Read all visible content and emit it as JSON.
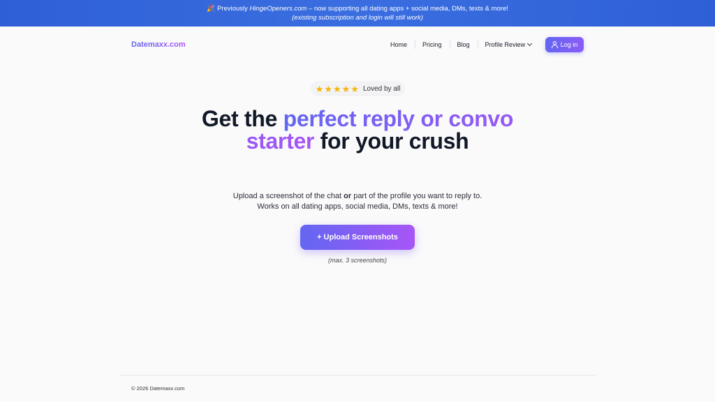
{
  "banner": {
    "emoji": "🎉",
    "prefix": "Previously ",
    "old_domain": "HingeOpeners.com",
    "suffix": " – now supporting all dating apps + social media, DMs, texts & more!",
    "line2": "(existing subscription and login will still work)"
  },
  "nav": {
    "logo": "Datemaxx.com",
    "links": [
      "Home",
      "Pricing",
      "Blog",
      "Profile Review"
    ],
    "login_label": "Log in"
  },
  "rating": {
    "stars": 5,
    "text": "Loved by all"
  },
  "hero": {
    "title_part1": "Get the ",
    "title_highlight": "perfect reply or convo starter",
    "title_part2": " for your crush",
    "sub_part1": "Upload a screenshot of the chat ",
    "sub_bold": "or",
    "sub_part2": " part of the profile you want to reply to.",
    "sub_line2": "Works on all dating apps, social media, DMs, texts & more!",
    "upload_label": "+ Upload Screenshots",
    "max_note": "(max. 3 screenshots)"
  },
  "footer": {
    "copyright": "© 2026 Datemaxx.com"
  },
  "colors": {
    "banner": "#2f5fd6",
    "gradient_start": "#6366f1",
    "gradient_end": "#a855f7",
    "star": "#f5b40a"
  }
}
